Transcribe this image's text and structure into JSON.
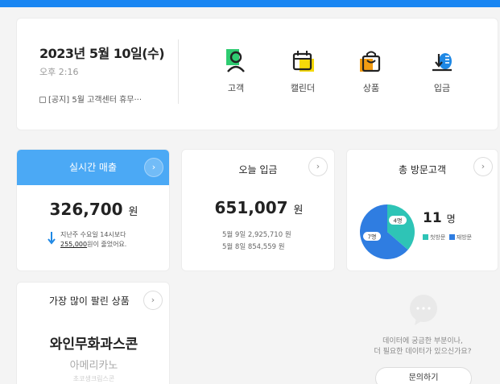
{
  "header": {
    "date": "2023년 5월 10일(수)",
    "time": "오후 2:16",
    "notice": "[공지] 5월 고객센터 휴무···"
  },
  "shortcuts": [
    {
      "label": "고객",
      "icon": "person-icon",
      "color": "#2ecc71"
    },
    {
      "label": "캘린더",
      "icon": "calendar-icon",
      "color": "#f5d90a"
    },
    {
      "label": "상품",
      "icon": "bag-icon",
      "color": "#f39c12"
    },
    {
      "label": "입금",
      "icon": "deposit-icon",
      "color": "#1e88e5"
    }
  ],
  "sales": {
    "title": "실시간 매출",
    "value": "326,700",
    "unit": "원",
    "note_line1": "지난주 수요일 14시보다",
    "note_amount": "255,000",
    "note_line2_suffix": "원이 줄었어요.",
    "header_color": "#4ba9f5"
  },
  "deposit": {
    "title": "오늘 입금",
    "value": "651,007",
    "unit": "원",
    "lines": [
      "5월 9일 2,925,710 원",
      "5월 8일   854,559 원"
    ]
  },
  "visitors": {
    "title": "총 방문고객",
    "count": "11",
    "unit": "명",
    "slice_new_label": "4명",
    "slice_return_label": "7명",
    "new_count": 4,
    "return_count": 7,
    "legend_new": "첫방문",
    "legend_return": "재방문",
    "color_new": "#2ec4b6",
    "color_return": "#2f7de1"
  },
  "best": {
    "title": "가장 많이 팔린 상품",
    "rank1": "와인무화과스콘",
    "rank2": "아메리카노",
    "rank3": "초코생크림스콘"
  },
  "ask": {
    "text_line1": "데이터에 궁금한 부분이나,",
    "text_line2": "더 필요한 데이터가 있으신가요?",
    "button": "문의하기"
  },
  "buttons": {
    "arrow": "›"
  }
}
